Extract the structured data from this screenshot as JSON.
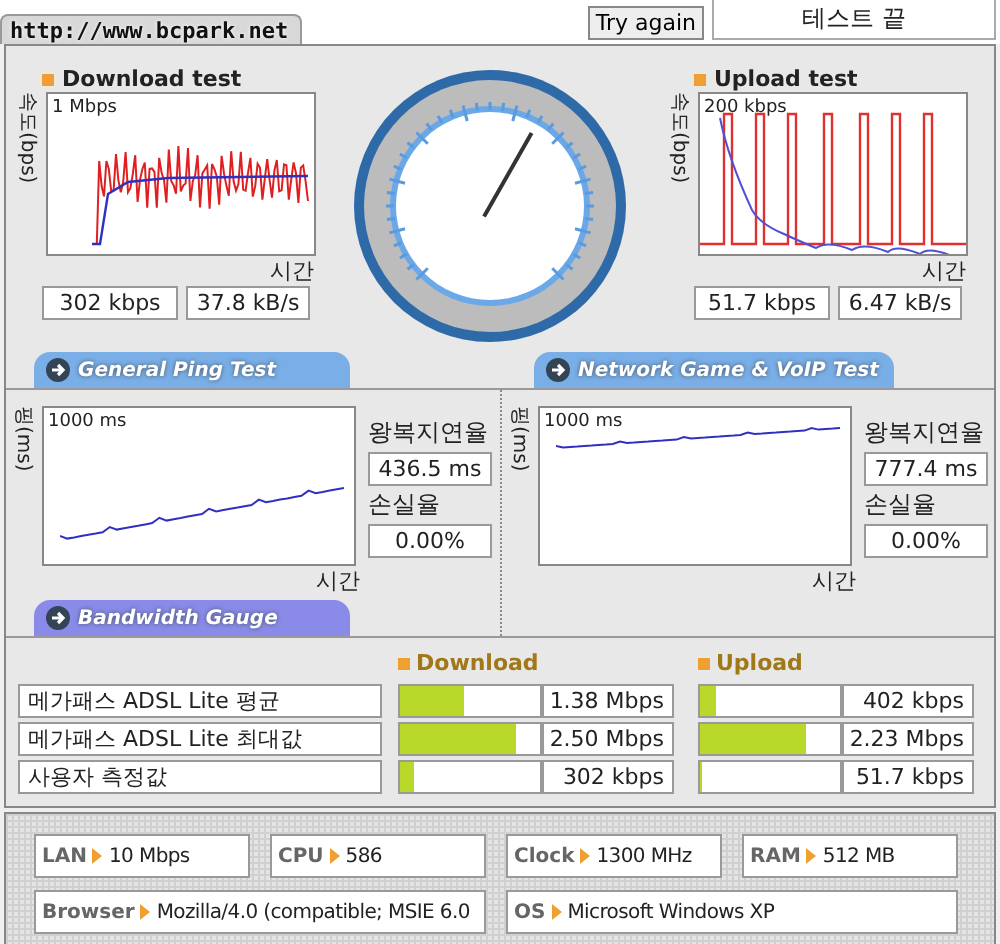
{
  "header": {
    "site": "http://www.bcpark.net",
    "retry_button": "Try again",
    "status": "테스트 끝"
  },
  "download": {
    "title": "Download test",
    "axis_label": "속도(bps)",
    "scale": "1 Mbps",
    "time_label": "시간",
    "rate": "302 kbps",
    "bytes": "37.8 kB/s"
  },
  "gauge": {
    "level": 0.61
  },
  "upload": {
    "title": "Upload test",
    "axis_label": "속도(bps)",
    "scale": "200 kbps",
    "time_label": "시간",
    "rate": "51.7 kbps",
    "bytes": "6.47 kB/s"
  },
  "section_tabs": [
    {
      "label": "General Ping Test",
      "color": "#7aaee6"
    },
    {
      "label": "Network Game & VoIP Test",
      "color": "#7aaee6"
    }
  ],
  "ping_panels": [
    {
      "axis_label": "핑(ms)",
      "scale": "1000 ms",
      "time_label": "시간",
      "latency_label": "왕복지연율",
      "latency": "436.5 ms",
      "loss_label": "손실율",
      "loss": "0.00%"
    },
    {
      "axis_label": "핑(ms)",
      "scale": "1000 ms",
      "time_label": "시간",
      "latency_label": "왕복지연율",
      "latency": "777.4 ms",
      "loss_label": "손실율",
      "loss": "0.00%"
    }
  ],
  "bandwidth": {
    "tab": "Bandwidth Gauge",
    "download_header": "Download",
    "upload_header": "Upload",
    "rows": [
      {
        "label": "메가패스 ADSL Lite 평균",
        "download_bar": {
          "level": 0.45
        },
        "download": "1.38 Mbps",
        "upload_bar": {
          "level": 0.12
        },
        "upload": "402 kbps"
      },
      {
        "label": "메가패스 ADSL Lite 최대값",
        "download_bar": {
          "level": 0.83
        },
        "download": "2.50 Mbps",
        "upload_bar": {
          "level": 0.75
        },
        "upload": "2.23 Mbps"
      },
      {
        "label": "사용자 측정값",
        "download_bar": {
          "level": 0.1
        },
        "download": "302 kbps",
        "upload_bar": {
          "level": 0.02
        },
        "upload": "51.7 kbps"
      }
    ]
  },
  "system_info": [
    {
      "label": "LAN",
      "value": "10 Mbps"
    },
    {
      "label": "CPU",
      "value": "586"
    },
    {
      "label": "Clock",
      "value": "1300 MHz"
    },
    {
      "label": "RAM",
      "value": "512 MB"
    },
    {
      "label": "Browser",
      "value": "Mozilla/4.0 (compatible; MSIE 6.0"
    },
    {
      "label": "OS",
      "value": "Microsoft Windows XP"
    }
  ]
}
